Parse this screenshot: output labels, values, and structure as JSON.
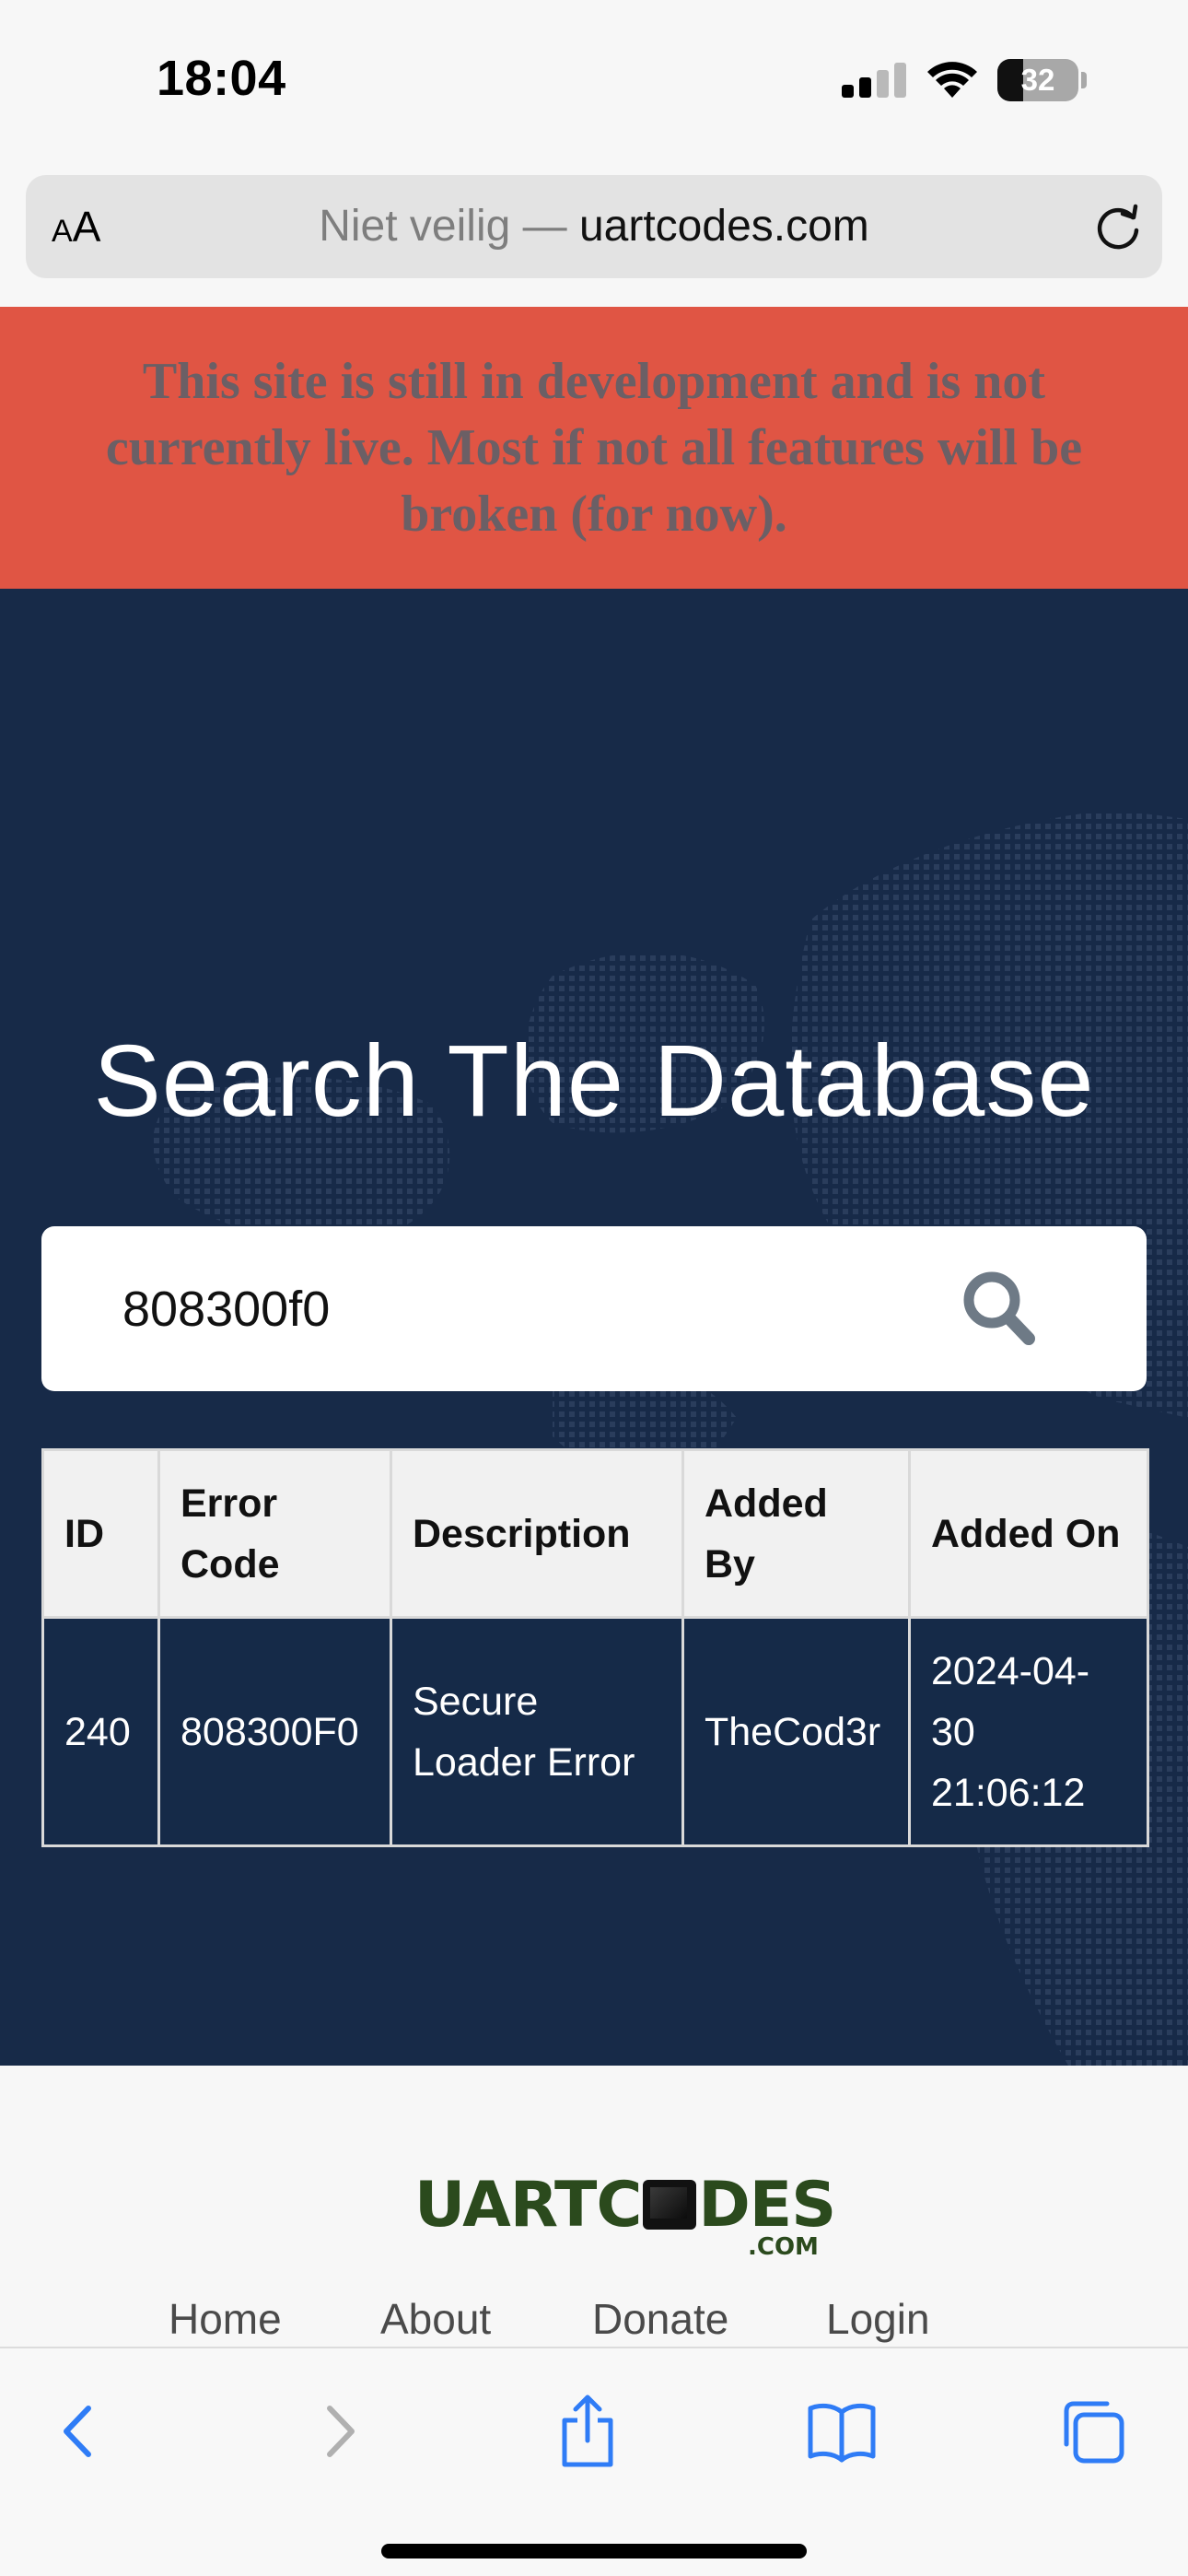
{
  "status_bar": {
    "time": "18:04",
    "battery_level": "32"
  },
  "address_bar": {
    "aa_label_small": "A",
    "aa_label_large": "A",
    "url_prefix": "Niet veilig — ",
    "url_domain": "uartcodes.com"
  },
  "banner": {
    "text": "This site is still in development and is not currently live. Most if not all features will be broken (for now)."
  },
  "hero": {
    "title": "Search The Database"
  },
  "search": {
    "value": "808300f0"
  },
  "results": {
    "headers": [
      "ID",
      "Error Code",
      "Description",
      "Added By",
      "Added On"
    ],
    "rows": [
      [
        "240",
        "808300F0",
        "Secure Loader Error",
        "TheCod3r",
        "2024-04-30 21:06:12"
      ]
    ]
  },
  "footer": {
    "logo": {
      "text_left": "UARTC",
      "text_right": "DES",
      "suffix": ".COM"
    },
    "nav": [
      "Home",
      "About",
      "Donate",
      "Login"
    ]
  },
  "colors": {
    "banner_bg": "#e05544",
    "banner_text": "#6b5f65",
    "hero_bg": "#172a48",
    "logo_green": "#2b4a1d",
    "toolbar_accent": "#2f7cf6",
    "toolbar_disabled": "#b0b0b0"
  },
  "icons": {
    "search": "magnifier-icon",
    "reload": "reload-icon",
    "back": "chevron-left-icon",
    "forward": "chevron-right-icon",
    "share": "share-icon",
    "bookmarks": "book-icon",
    "tabs": "tabs-icon"
  }
}
